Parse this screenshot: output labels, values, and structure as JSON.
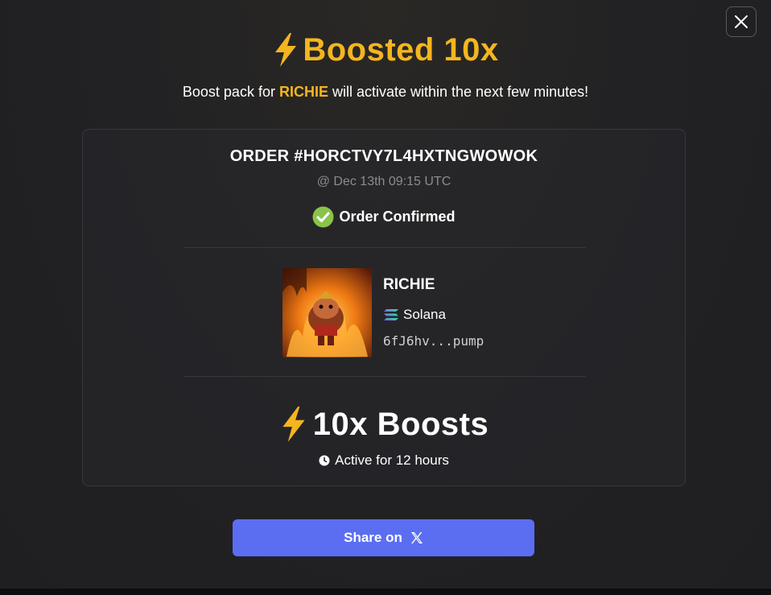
{
  "modal": {
    "close_icon": "close-icon",
    "title_icon": "lightning-bolt-icon",
    "title": "Boosted 10x",
    "subtitle": {
      "prefix": "Boost pack for ",
      "token": "RICHIE",
      "suffix": " will activate within the next few minutes!"
    }
  },
  "order": {
    "id": "ORDER #HORCTVY7L4HXTNGWOWOK",
    "time": "@ Dec 13th 09:15 UTC",
    "status_icon": "check-circle-icon",
    "status": "Order Confirmed"
  },
  "token": {
    "image_icon": "token-avatar",
    "name": "RICHIE",
    "chain_icon": "solana-icon",
    "chain": "Solana",
    "address": "6fJ6hv...pump"
  },
  "boost": {
    "icon": "lightning-bolt-icon",
    "amount": "10x Boosts",
    "duration_icon": "clock-icon",
    "duration": "Active for 12 hours"
  },
  "share": {
    "label": "Share on",
    "icon": "x-logo-icon"
  },
  "colors": {
    "accent": "#f5b51e",
    "success": "#8bc34a",
    "button": "#5b6ef2",
    "background": "#1f1f22"
  }
}
